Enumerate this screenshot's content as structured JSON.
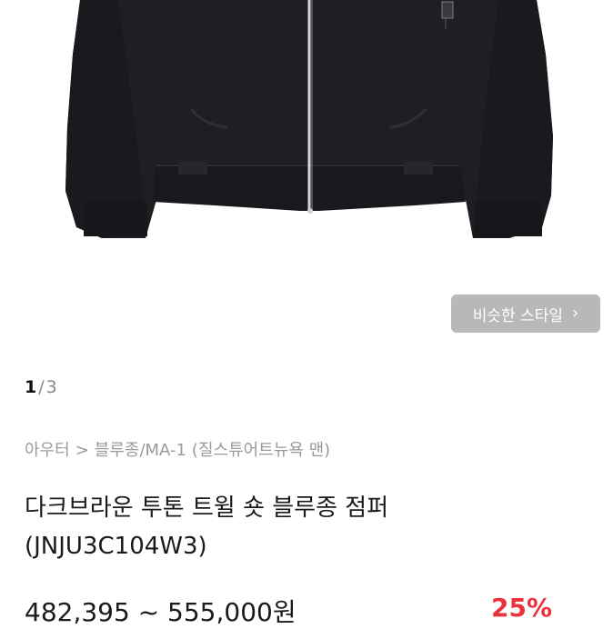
{
  "gallery": {
    "similar_style_label": "비슷한 스타일",
    "current_page": "1",
    "separator": "/",
    "total_pages": "3"
  },
  "breadcrumb": {
    "items": [
      "아우터",
      ">",
      "블루종/MA-1",
      "(질스튜어트뉴욕 맨)"
    ]
  },
  "product": {
    "name_line1": "다크브라운 투톤 트윌 숏 블루종 점퍼",
    "name_line2": "(JNJU3C104W3)",
    "price_range": "482,395 ~ 555,000원",
    "discount": "25%"
  },
  "colors": {
    "jacket": "#1e1f23",
    "button_bg": "#b8b8b8",
    "discount": "#e8333c"
  }
}
